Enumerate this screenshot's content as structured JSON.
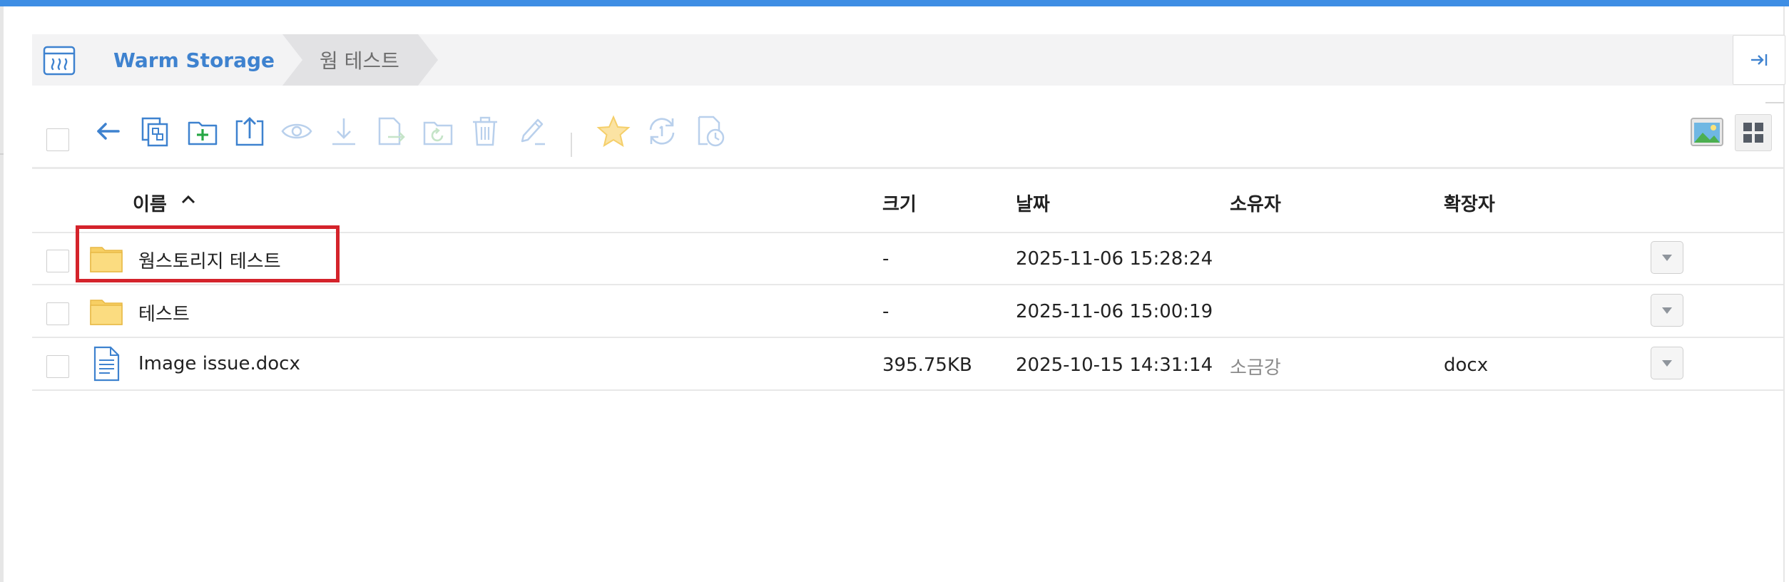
{
  "breadcrumb": {
    "home_icon": "warm-storage-icon",
    "items": [
      "Warm Storage",
      "웜 테스트"
    ]
  },
  "panel": {
    "collapse_icon": "collapse-right-icon"
  },
  "toolbar": {
    "icons": [
      "back-arrow-icon",
      "copy-icon",
      "new-folder-icon",
      "upload-icon",
      "preview-icon",
      "download-icon",
      "move-icon",
      "restore-icon",
      "delete-icon",
      "rename-icon",
      "favorite-star-icon",
      "sync-icon",
      "version-history-icon"
    ],
    "view_icons": [
      "image-view-icon",
      "grid-view-icon"
    ]
  },
  "columns": {
    "name": "이름",
    "size": "크기",
    "date": "날짜",
    "owner": "소유자",
    "extension": "확장자"
  },
  "sort": {
    "column": "name",
    "direction": "ascending"
  },
  "rows": [
    {
      "type": "folder",
      "name": "웜스토리지 테스트",
      "size": "-",
      "date": "2025-11-06 15:28:24",
      "owner": "",
      "extension": ""
    },
    {
      "type": "folder",
      "name": "테스트",
      "size": "-",
      "date": "2025-11-06 15:00:19",
      "owner": "",
      "extension": ""
    },
    {
      "type": "document",
      "name": "Image issue.docx",
      "size": "395.75KB",
      "date": "2025-10-15 14:31:14",
      "owner": "소금강",
      "extension": "docx"
    }
  ],
  "colors": {
    "accent": "#3e8ee4",
    "highlight": "#d4232b",
    "folder": "#f7cf63",
    "star": "#f9d26b"
  }
}
